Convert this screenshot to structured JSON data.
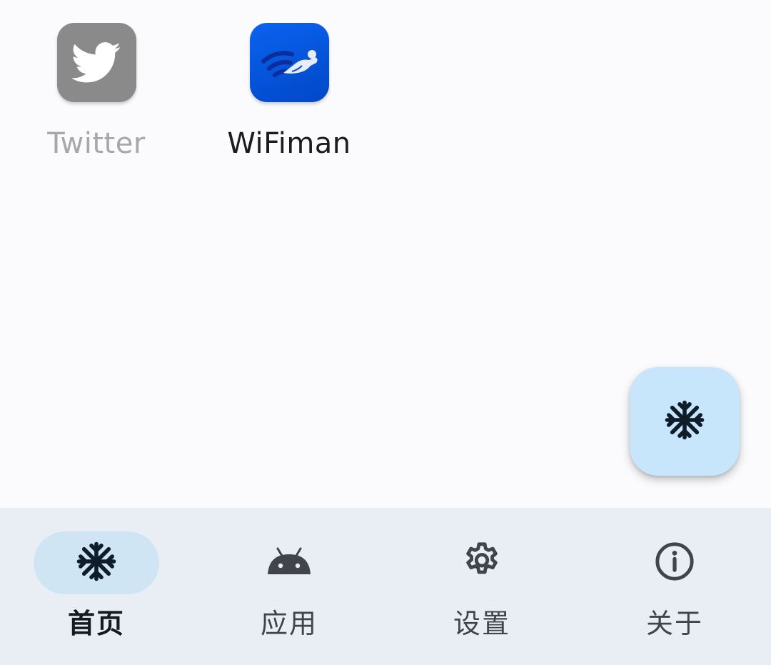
{
  "apps": [
    {
      "name": "Twitter",
      "icon": "twitter-bird-icon",
      "state": "frozen",
      "icon_color": "#8a8a8a"
    },
    {
      "name": "WiFiman",
      "icon": "wifiman-icon",
      "state": "normal",
      "icon_color": "#0a5be8"
    }
  ],
  "fab": {
    "icon": "snowflake-icon",
    "color": "#c8e6fb"
  },
  "nav": {
    "items": [
      {
        "label": "首页",
        "icon": "snowflake-icon",
        "active": true
      },
      {
        "label": "应用",
        "icon": "android-icon",
        "active": false
      },
      {
        "label": "设置",
        "icon": "gear-icon",
        "active": false
      },
      {
        "label": "关于",
        "icon": "info-icon",
        "active": false
      }
    ],
    "background": "#e9eef5",
    "active_indicator_color": "#d0e5f3"
  },
  "colors": {
    "background": "#fbfbfe",
    "frozen_text": "#a7a7aa",
    "text": "#1c1c1f"
  }
}
